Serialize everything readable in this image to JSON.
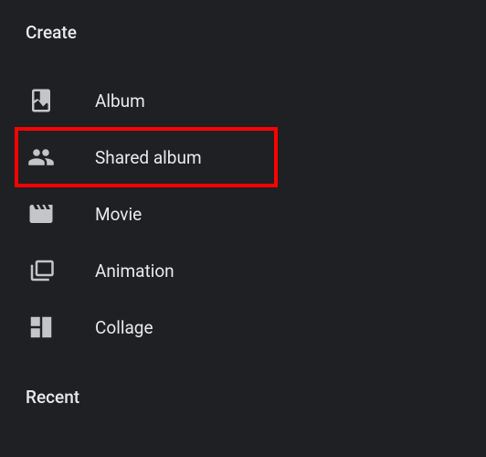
{
  "sections": {
    "create": {
      "header": "Create",
      "items": [
        {
          "label": "Album"
        },
        {
          "label": "Shared album"
        },
        {
          "label": "Movie"
        },
        {
          "label": "Animation"
        },
        {
          "label": "Collage"
        }
      ]
    },
    "recent": {
      "header": "Recent"
    }
  },
  "highlight": {
    "color": "#ff0000"
  }
}
